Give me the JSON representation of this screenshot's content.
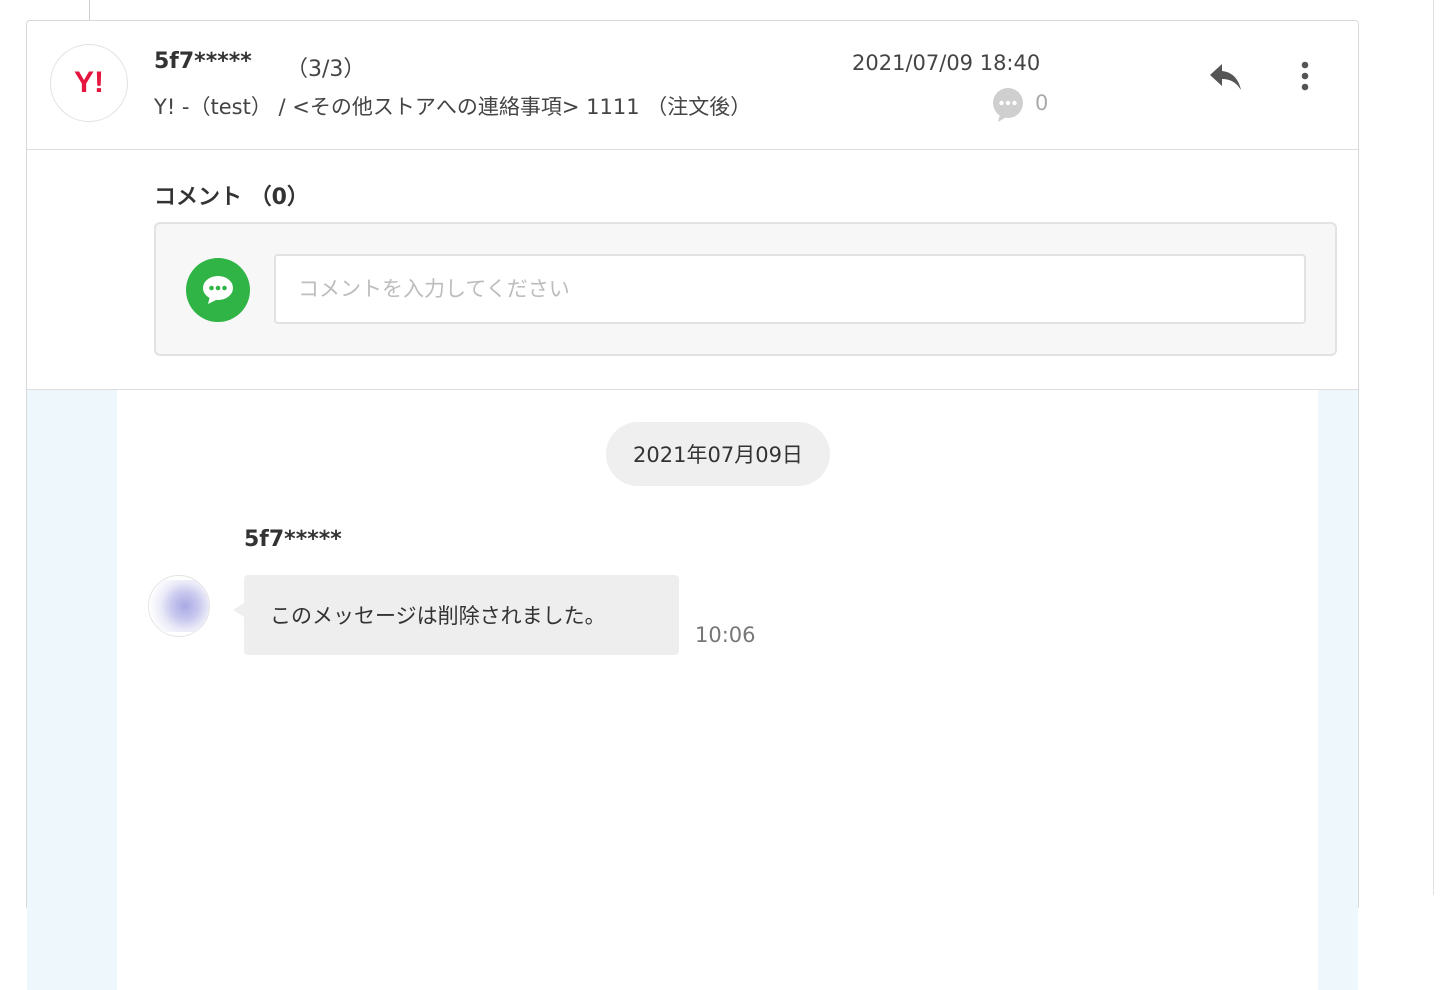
{
  "thread": {
    "store_logo": "Y!",
    "customer_name": "5f7*****",
    "message_count": "（3/3）",
    "subject": "Y! -（test） / <その他ストアへの連絡事項> 1111 （注文後）",
    "datetime": "2021/07/09 18:40",
    "comment_count": "0",
    "reply_icon": "reply-icon",
    "more_icon": "more-vertical-icon"
  },
  "comments": {
    "title": "コメント （0）",
    "input_placeholder": "コメントを入力してください",
    "input_value": "",
    "icon": "comment-icon"
  },
  "messages": {
    "date_label": "2021年07月09日",
    "items": [
      {
        "sender": "5f7*****",
        "text": "このメッセージは削除されました。",
        "time": "10:06"
      }
    ]
  },
  "colors": {
    "brand_yahoo": "#e6153e",
    "comment_green": "#2fb445",
    "message_area_bg": "#eef7fc"
  }
}
